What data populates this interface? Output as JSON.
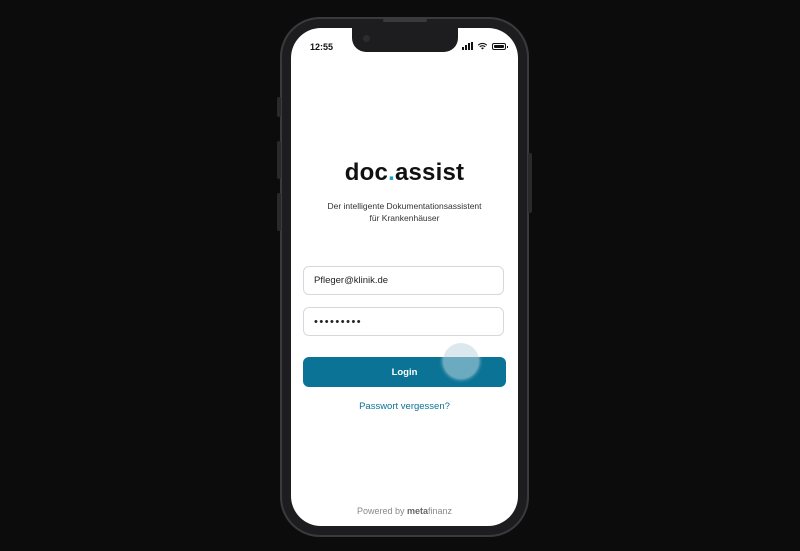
{
  "status_bar": {
    "time": "12:55"
  },
  "app": {
    "logo_part1": "doc",
    "logo_dot": ".",
    "logo_part2": "assist",
    "tagline_line1": "Der intelligente Dokumentationsassistent",
    "tagline_line2": "für Krankenhäuser"
  },
  "login_form": {
    "email_value": "Pfleger@klinik.de",
    "password_value": "•••••••••",
    "login_label": "Login",
    "forgot_password_label": "Passwort vergessen?"
  },
  "footer": {
    "powered_by": "Powered by",
    "brand_bold": "meta",
    "brand_light": "finanz"
  },
  "colors": {
    "accent": "#0a7396",
    "logo_dot": "#1aa3c4",
    "background": "#0c0c0c"
  },
  "icons": [
    "signal-icon",
    "wifi-icon",
    "battery-icon"
  ]
}
